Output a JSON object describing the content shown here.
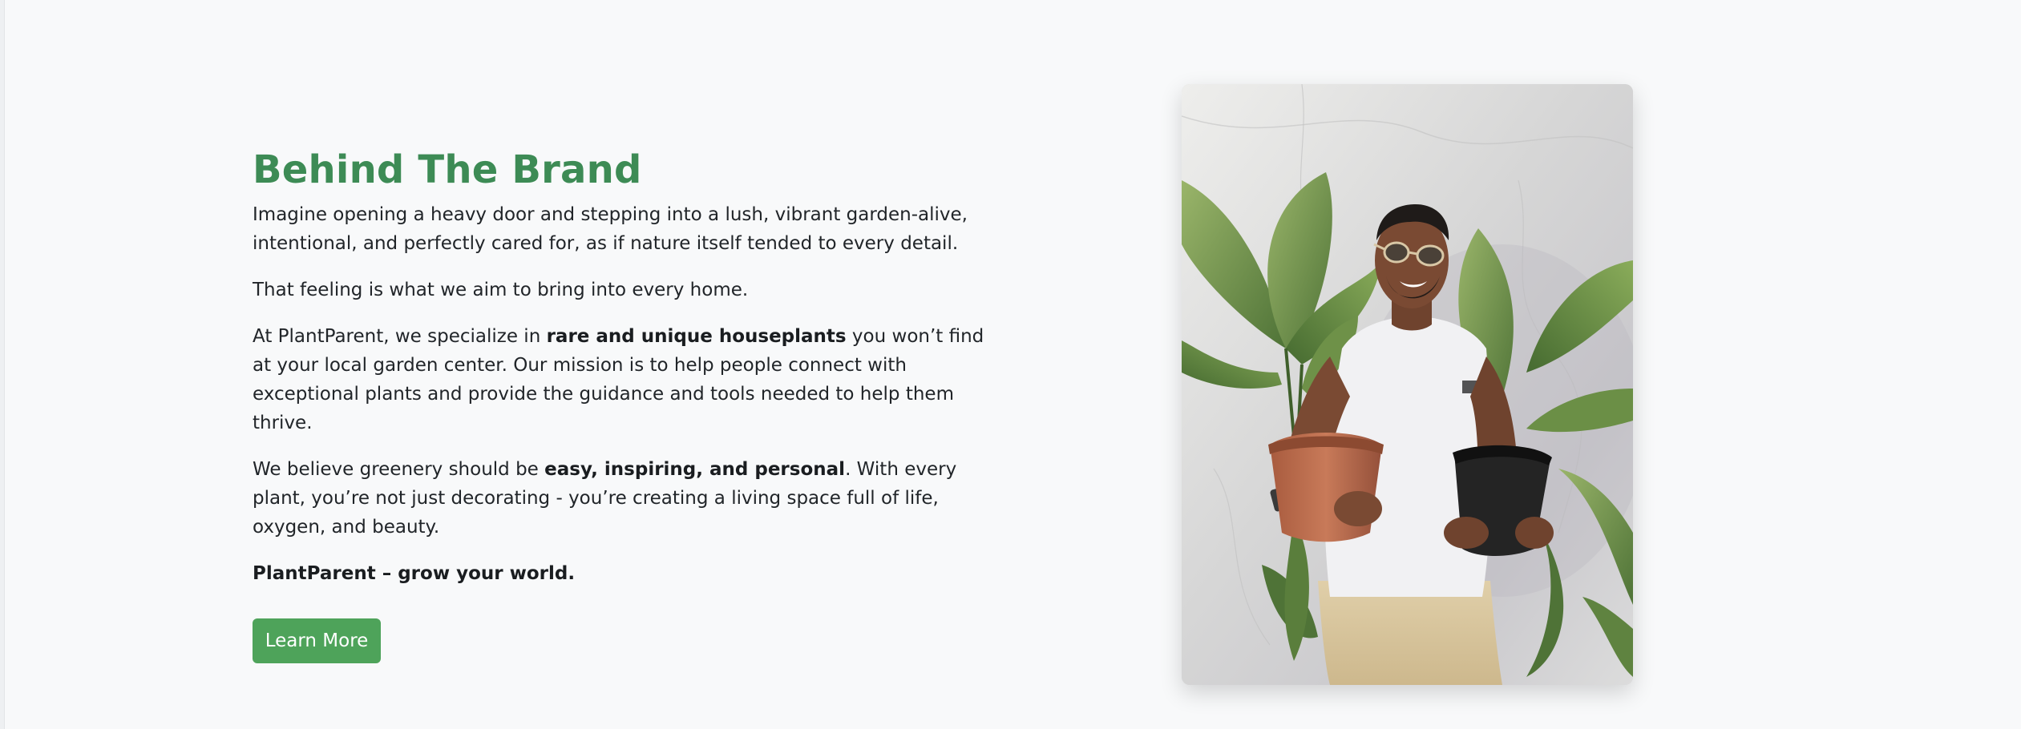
{
  "about": {
    "title": "Behind The Brand",
    "p1": "Imagine opening a heavy door and stepping into a lush, vibrant garden-alive, intentional, and perfectly cared for, as if nature itself tended to every detail.",
    "p2": "That feeling is what we aim to bring into every home.",
    "p3_pre": "At PlantParent, we specialize in ",
    "p3_bold": "rare and unique houseplants",
    "p3_post": " you won’t find at your local garden center. Our mission is to help people connect with exceptional plants and provide the guidance and tools needed to help them thrive.",
    "p4_pre": "We believe greenery should be ",
    "p4_bold": "easy, inspiring, and personal",
    "p4_post": ". With every plant, you’re not just decorating - you’re creating a living space full of life, oxygen, and beauty.",
    "tagline": "PlantParent – grow your world.",
    "button_label": "Learn More"
  },
  "image": {
    "subject": "man holding two potted plants",
    "colors": {
      "accent": "#3d8b55",
      "button": "#4ea35a",
      "background": "#f8f9fa"
    }
  }
}
